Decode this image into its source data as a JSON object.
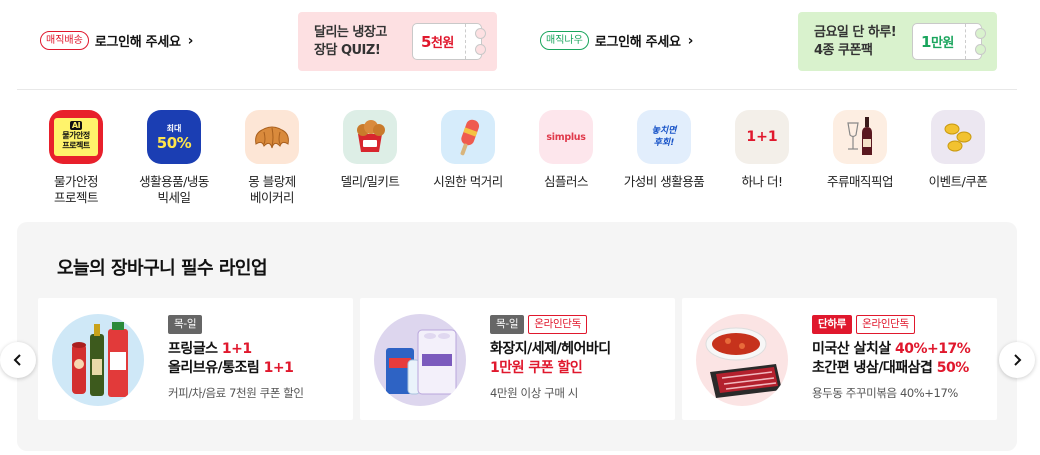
{
  "top": {
    "left_login": {
      "tag": "매직배송",
      "text": "로그인해 주세요"
    },
    "right_login": {
      "tag": "매직나우",
      "text": "로그인해 주세요"
    },
    "promo_left": {
      "text": "달리는 냉장고\n장담 QUIZ!",
      "coupon_num": "5",
      "coupon_unit": "천원"
    },
    "promo_right": {
      "text": "금요일 단 하루!\n4종 쿠폰팩",
      "coupon_num": "1",
      "coupon_unit": "만원"
    },
    "colors": {
      "red": "#e0182d",
      "green": "#1aa55d",
      "pink_bg": "#fde0e2",
      "green_bg": "#d9f2cd"
    }
  },
  "categories": [
    {
      "label": "물가안정 프로젝트",
      "icon": "price-stability-project-icon",
      "art": "AI 물가안정 프로젝트"
    },
    {
      "label": "생활용품/냉동 빅세일",
      "icon": "max-50-percent-icon",
      "art_small": "최대",
      "art_big": "50%"
    },
    {
      "label": "몽 블랑제 베이커리",
      "icon": "croissant-icon"
    },
    {
      "label": "델리/밀키트",
      "icon": "fried-chicken-icon"
    },
    {
      "label": "시원한 먹거리",
      "icon": "popsicle-icon"
    },
    {
      "label": "심플러스",
      "icon": "simplus-logo-icon",
      "art": "simplus"
    },
    {
      "label": "가성비 생활용품",
      "icon": "value-goods-icon",
      "art": "놓치면\n후회!"
    },
    {
      "label": "하나 더!",
      "icon": "one-plus-one-icon",
      "art": "1+1"
    },
    {
      "label": "주류매직픽업",
      "icon": "wine-bottle-icon"
    },
    {
      "label": "이벤트/쿠폰",
      "icon": "coins-icon"
    }
  ],
  "lineup": {
    "title": "오늘의 장바구니 필수 라인업",
    "cards": [
      {
        "badges": [
          {
            "text": "목-일",
            "style": "gray"
          }
        ],
        "line1": "프링글스 ",
        "line1_red": "1+1",
        "line2": "올리브유/통조림 ",
        "line2_red": "1+1",
        "sub": "커피/차/음료 7천원 쿠폰 할인"
      },
      {
        "badges": [
          {
            "text": "목-일",
            "style": "gray"
          },
          {
            "text": "온라인단독",
            "style": "outline"
          }
        ],
        "line1": "화장지/세제/헤어바디",
        "line1_red": "",
        "line2": "",
        "line2_red": "1만원 쿠폰 할인",
        "sub": "4만원 이상 구매 시"
      },
      {
        "badges": [
          {
            "text": "단하루",
            "style": "red"
          },
          {
            "text": "온라인단독",
            "style": "outline"
          }
        ],
        "line1": "미국산 살치살 ",
        "line1_red": "40%+17%",
        "line2": "초간편 냉삼/대패삼겹 ",
        "line2_red": "50%",
        "sub": "용두동 주꾸미볶음 40%+17%"
      }
    ]
  }
}
